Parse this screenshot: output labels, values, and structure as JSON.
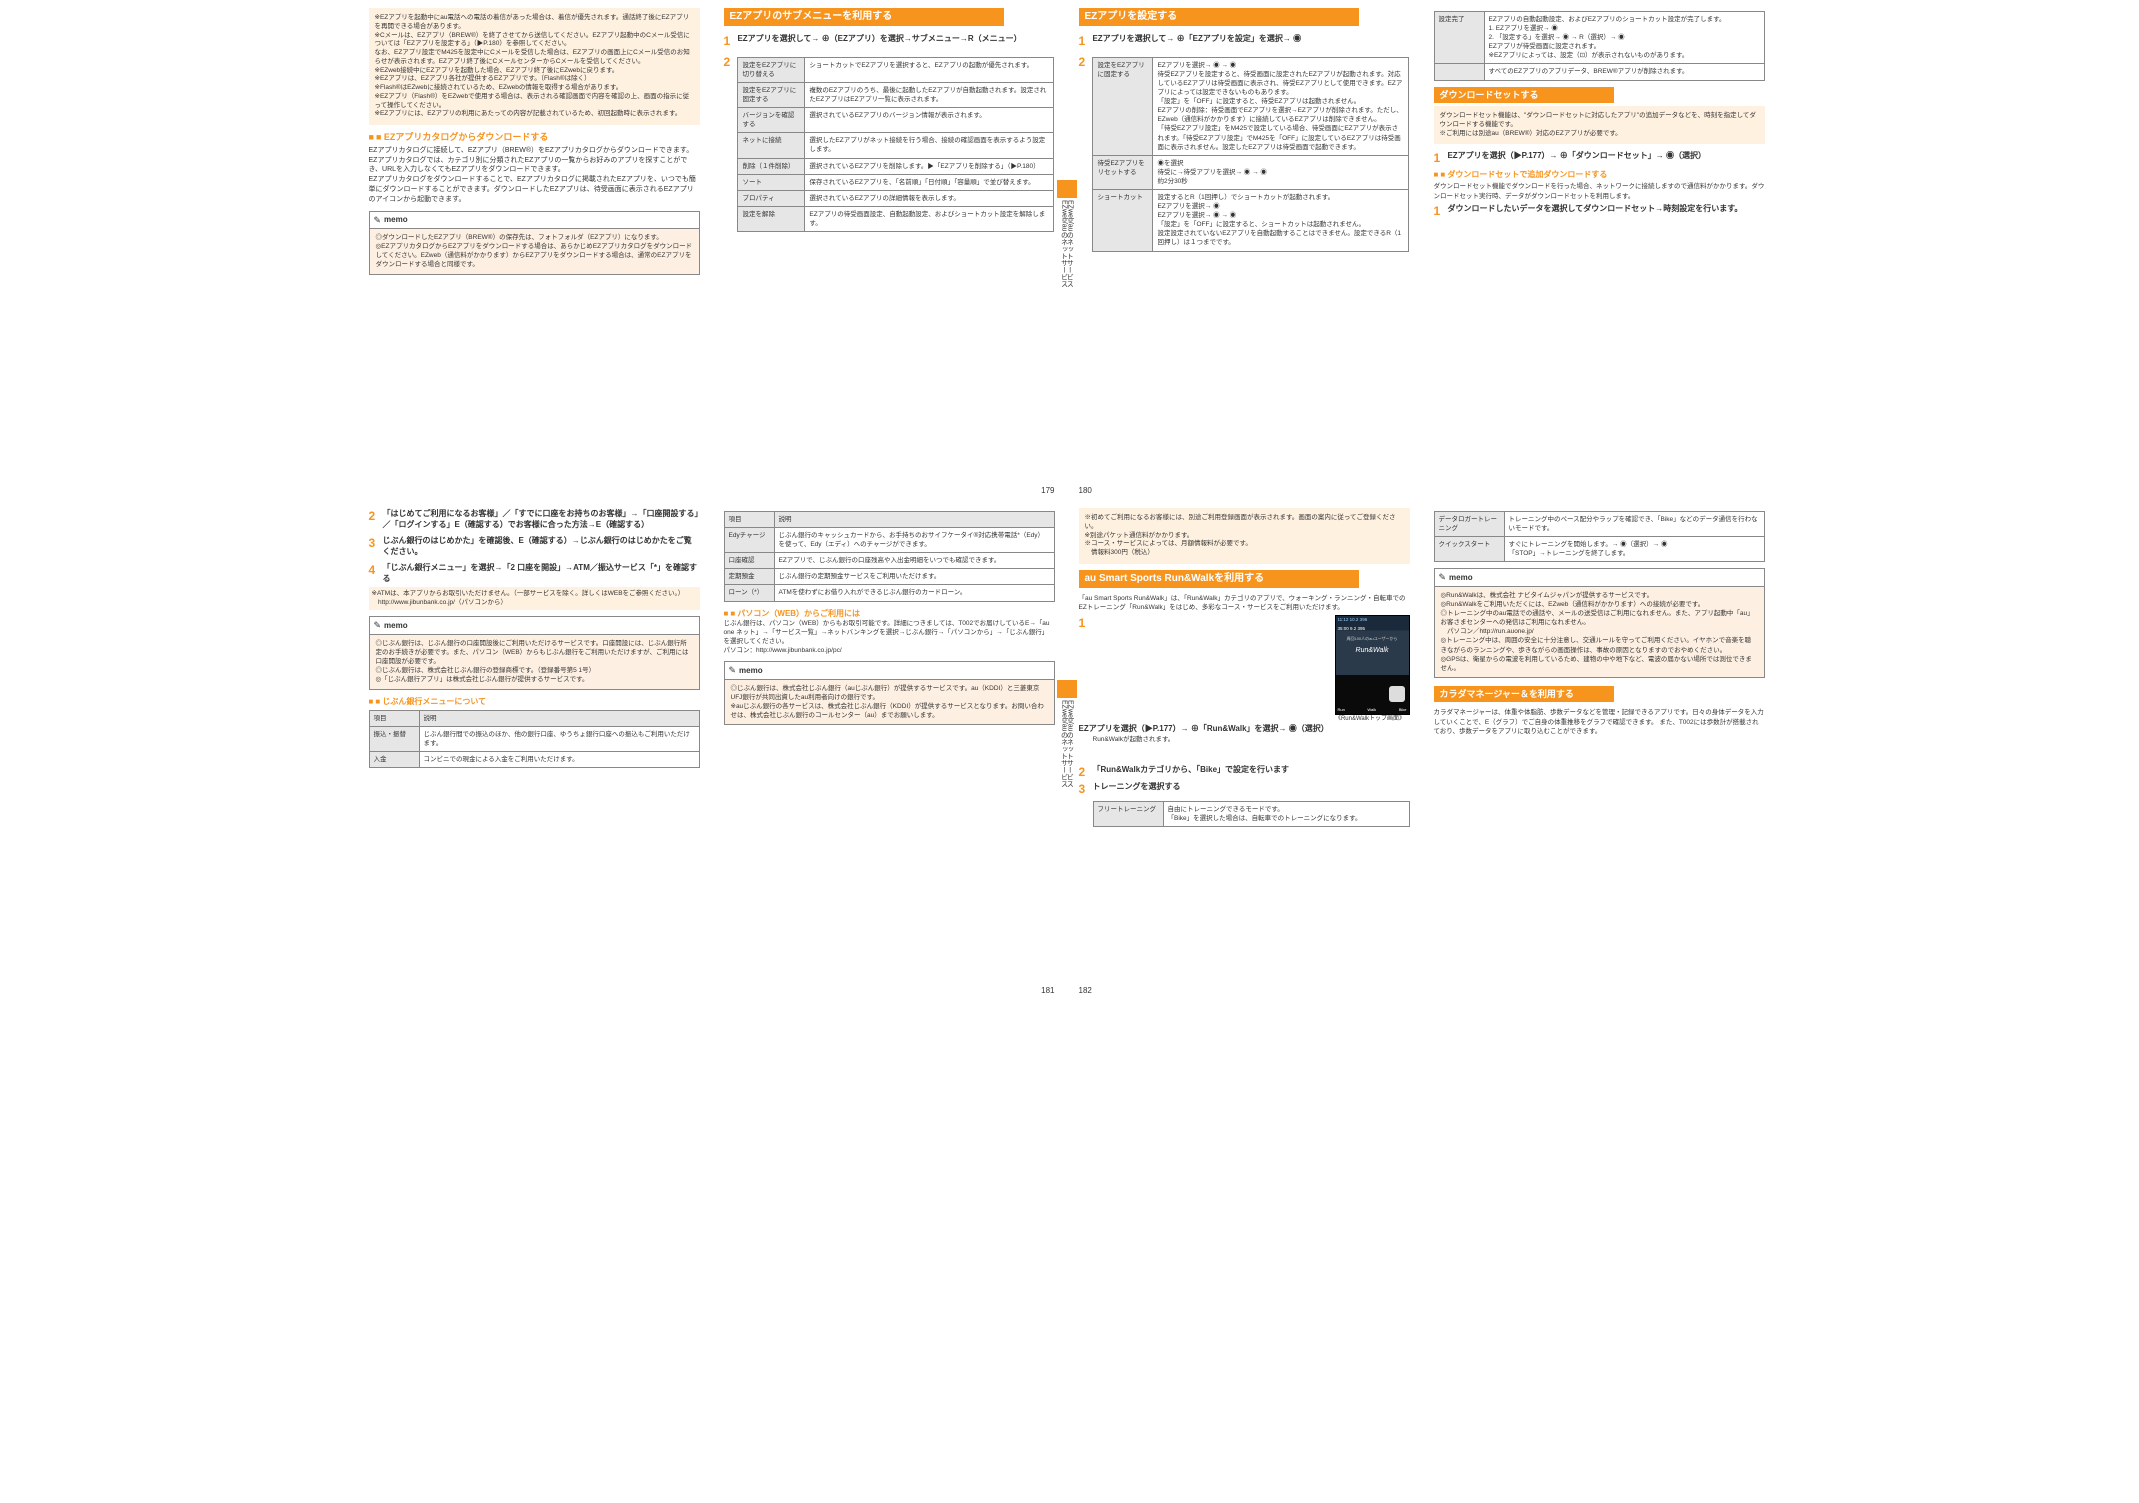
{
  "sidetab_label": "EZweb/auのネットサービス",
  "p179": {
    "note_text": "※EZアプリを起動中にau電話への電話の着信があった場合は、着信が優先されます。通話終了後にEZアプリを再開できる場合があります。\n※Cメールは、EZアプリ（BREW®）を終了させてから送信してください。EZアプリ起動中のCメール受信については「EZアプリを設定する」（▶P.180）を参照してください。\nなお、EZアプリ設定でM425を設定中にCメールを受信した場合は、EZアプリの画面上にCメール受信のお知らせが表示されます。EZアプリ終了後にCメールセンターからCメールを受信してください。\n※EZweb接続中にEZアプリを起動した場合、EZアプリ終了後にEZwebに戻ります。\n※EZアプリは、EZアプリ各社が提供するEZアプリです。（Flash®は除く）\n※Flash®はEZwebに接続されているため、EZwebの情報を取得する場合があります。\n※EZアプリ（Flash®）をEZwebで使用する場合は、表示される確認画面で内容を確認の上、画面の指示に従って操作してください。\n※EZアプリには、EZアプリの利用にあたっての内容が記載されているため、初回起動時に表示されます。",
    "heading1": "■ EZアプリカタログからダウンロードする",
    "body1": "EZアプリカタログに接続して、EZアプリ（BREW®）をEZアプリカタログからダウンロードできます。EZアプリカタログでは、カテゴリ別に分類されたEZアプリの一覧からお好みのアプリを探すことができ、URLを入力しなくてもEZアプリをダウンロードできます。\nEZアプリカタログをダウンロードすることで、EZアプリカタログに掲載されたEZアプリを、いつでも簡単にダウンロードすることができます。ダウンロードしたEZアプリは、待受画面に表示されるEZアプリのアイコンから起動できます。",
    "memo_label": "memo",
    "memo_body": "◎ダウンロードしたEZアプリ（BREW®）の保存先は、フォトフォルダ（EZアプリ）になります。\n◎EZアプリカタログからEZアプリをダウンロードする場合は、あらかじめEZアプリカタログをダウンロードしてください。EZweb（通信料がかかります）からEZアプリをダウンロードする場合は、通常のEZアプリをダウンロードする場合と同様です。",
    "sec_title": "EZアプリのサブメニューを利用する",
    "step1_label": "1",
    "step1_text": "EZアプリを選択して→ ⊕（EZアプリ）を選択→サブメニュー→R（メニュー）",
    "step2_label": "2",
    "table": [
      [
        "設定をEZアプリに切り替える",
        "ショートカットでEZアプリを選択すると、EZアプリの起動が優先されます。"
      ],
      [
        "設定をEZアプリに固定する",
        "複数のEZアプリのうち、最後に起動したEZアプリが自動起動されます。設定されたEZアプリはEZアプリ一覧に表示されます。"
      ],
      [
        "バージョンを確認する",
        "選択されているEZアプリのバージョン情報が表示されます。"
      ],
      [
        "ネットに接続",
        "選択したEZアプリがネット接続を行う場合、接続の確認画面を表示するよう設定します。"
      ],
      [
        "削除（１件削除）",
        "選択されているEZアプリを削除します。▶「EZアプリを削除する」（▶P.180）"
      ],
      [
        "ソート",
        "保存されているEZアプリを、「名前順」「日付順」「容量順」で並び替えます。"
      ],
      [
        "プロパティ",
        "選択されているEZアプリの詳細情報を表示します。"
      ],
      [
        "設定を解除",
        "EZアプリの待受画面設定、自動起動設定、およびショートカット設定を解除します。"
      ]
    ],
    "pagenum": "179"
  },
  "p180": {
    "sec_title": "EZアプリを設定する",
    "step1_label": "1",
    "step1_text": "EZアプリを選択して→ ⊕「EZアプリを設定」を選択→ ◉",
    "step2_label": "2",
    "table": [
      {
        "h": "設定をEZアプリに固定する",
        "rows": [
          "EZアプリを選択→ ◉ → ◉\n待受EZアプリを設定すると、待受画面に設定されたEZアプリが起動されます。対応しているEZアプリは待受画面に表示され、待受EZアプリとして使用できます。EZアプリによっては設定できないものもあります。\n「設定」を「OFF」に設定すると、待受EZアプリは起動されません。\nEZアプリの削除：待受画面でEZアプリを選択→EZアプリが削除されます。ただし、EZweb（通信料がかかります）に接続しているEZアプリは削除できません。\n「待受EZアプリ設定」をM425で設定している場合、待受画面にEZアプリが表示されます。「待受EZアプリ設定」でM425を「OFF」に設定しているEZアプリは待受画面に表示されません。設定したEZアプリは待受画面で起動できます。"
        ]
      },
      {
        "h": "待受EZアプリをリセットする",
        "rows": [
          "◉を選択\n待受に→待受アプリを選択→ ◉ → ◉\n約2分30秒"
        ]
      },
      {
        "h": "ショートカット",
        "rows": [
          "設定するとR（1回押し）でショートカットが起動されます。\nEZアプリを選択→ ◉\nEZアプリを選択→ ◉ → ◉\n「設定」を「OFF」に設定すると、ショートカットは起動されません。\n設定設定されていないEZアプリを自動起動することはできません。設定できるR（1回押し）は１つまでです。"
        ]
      }
    ],
    "side_table": [
      [
        "設定完了",
        "EZアプリの自動起動設定、およびEZアプリのショートカット設定が完了します。\n1. EZアプリを選択→ ◉\n2. 「設定する」を選択→ ◉ → R（選択）→ ◉\nEZアプリが待受画面に設定されます。\n※EZアプリによっては、設定（⊡）が表示されないものがあります。"
      ],
      [
        "",
        "すべてのEZアプリのアプリデータ、BREW®アプリが削除されます。"
      ]
    ],
    "pagenum": "180"
  },
  "p180r": {
    "sec_title": "ダウンロードセットする",
    "note": "ダウンロードセット機能は、\"ダウンロードセットに対応したアプリ\"の追加データなどを、時刻を指定してダウンロードする機能です。\n※ご利用には別途au（BREW®）対応のEZアプリが必要です。",
    "step1_label": "1",
    "step1_text": "EZアプリを選択（▶P.177）→ ⊕「ダウンロードセット」→ ◉（選択）",
    "sub_heading": "■ ダウンロードセットで追加ダウンロードする",
    "body": "ダウンロードセット機能でダウンロードを行った場合、ネットワークに接続しますので通信料がかかります。ダウンロードセット実行時、データがダウンロードセットを利用します。",
    "step1b_label": "1",
    "step1b_text": "ダウンロードしたいデータを選択してダウンロードセット→時刻設定を行います。"
  },
  "p181": {
    "step2_label": "2",
    "step2_text": "「はじめてご利用になるお客様」／「すでに口座をお持ちのお客様」→「口座開設する」／「ログインする」E（確認する）でお客様に合った方法→E（確認する）",
    "step3_label": "3",
    "step3_text": "じぶん銀行のはじめかた」を確認後、E（確認する）→じぶん銀行のはじめかたをご覧ください。",
    "step4_label": "4",
    "step4_text": "「じぶん銀行メニュー」を選択→「2 口座を開設」→ATM／振込サービス「*」を確認する",
    "footnote4": "※ATMは、本アプリからお取引いただけません。（一部サービスを除く。詳しくはWEBをご参照ください。）\n　http://www.jibunbank.co.jp/（パソコンから）",
    "memo_label": "memo",
    "memo_body": "◎じぶん銀行は、じぶん銀行の口座開設後にご利用いただけるサービスです。口座開設には、じぶん銀行所定のお手続きが必要です。また、パソコン（WEB）からもじぶん銀行をご利用いただけますが、ご利用には口座開設が必要です。\n◎じぶん銀行は、株式会社じぶん銀行の登録商標です。（登録番号第5 1号）\n◎「じぶん銀行アプリ」は株式会社じぶん銀行が提供するサービスです。",
    "sub_heading": "■ じぶん銀行メニューについて",
    "table1": [
      [
        "項目",
        "説明"
      ],
      [
        "振込・振替",
        "じぶん銀行間での振込のほか、他の銀行口座、ゆうちょ銀行口座への振込もご利用いただけます。"
      ],
      [
        "入金",
        "コンビニでの現金による入金をご利用いただけます。"
      ]
    ],
    "table2": [
      [
        "項目",
        "説明"
      ],
      [
        "Edyチャージ",
        "じぶん銀行のキャッシュカードから、お手持ちのおサイフケータイ®対応携帯電話*（Edy）を使って、Edy（エディ）へのチャージができます。"
      ],
      [
        "口座確認",
        "EZアプリで、じぶん銀行の口座残高や入出金明細をいつでも確認できます。"
      ],
      [
        "定期預金",
        "じぶん銀行の定期預金サービスをご利用いただけます。"
      ],
      [
        "ローン（*）",
        "ATMを使わずにお借り入れができるじぶん銀行のカードローン。"
      ]
    ],
    "sec_web": "■ パソコン（WEB）からご利用には",
    "web_body": "じぶん銀行は、パソコン（WEB）からもお取引可能です。詳細につきましては、T002でお届けしているE→「au one ネット」→「サービス一覧」→ネットバンキングを選択→じぶん銀行→「パソコンから」→「じぶん銀行」を選択してください。\nパソコン：http://www.jibunbank.co.jp/pc/",
    "memo2_body": "◎じぶん銀行は、株式会社じぶん銀行（auじぶん銀行）が提供するサービスです。au（KDDI）と三菱東京UFJ銀行が共同出資したau利用者向けの銀行です。\n※auじぶん銀行の各サービスは、株式会社じぶん銀行（KDDI）が提供するサービスとなります。お問い合わせは、株式会社じぶん銀行のコールセンター（au）までお願いします。",
    "pagenum": "181"
  },
  "p182": {
    "top_note": "※初めてご利用になるお客様には、別途ご利用登録画面が表示されます。画面の案内に従ってご登録ください。\n※別途パケット通信料がかかります。\n※コース・サービスによっては、月額情報料が必要です。\n　情報料300円（税込）",
    "sec_title": "au Smart Sports Run&Walkを利用する",
    "intro": "「au Smart Sports Run&Walk」は、「Run&Walk」カテゴリのアプリで、ウォーキング・ランニング・自転車でのEZトレーニング「Run&Walk」をはじめ、多彩なコース・サービスをご利用いただけます。",
    "step1_label": "1",
    "step1_text": "EZアプリを選択（▶P.177）→ ⊕「Run&Walk」を選択→ ◉（選択）",
    "step1_sub": "Run&Walkが起動されます。",
    "step2_label": "2",
    "step2_text": "「Run&Walkカテゴリから、「Bike」で設定を行います",
    "step3_label": "3",
    "step3_text": "トレーニングを選択する",
    "table": [
      [
        "フリートレーニング",
        "自由にトレーニングできるモードです。\n「Bike」を選択した場合は、自転車でのトレーニングになります。"
      ]
    ],
    "screenshot_caption": "《Run&Walkトップ画面》",
    "scr": {
      "top": "11:12  10.2  396",
      "mid": "35:00  9.2  395",
      "blurb": "周回100人のauユーザーから",
      "title": "Run&Walk",
      "menu1": "Run",
      "menu2": "Walk",
      "menu3": "Bike"
    },
    "right_table": [
      [
        "データロガートレーニング",
        "トレーニング中のペース配分やラップを確認でき、「Bike」などのデータ通信を行わないモードです。"
      ],
      [
        "クイックスタート",
        "すぐにトレーニングを開始します。→ ◉（選択）→ ◉\n「STOP」→トレーニングを終了します。"
      ]
    ],
    "memo_label": "memo",
    "memo_body": "◎Run&Walkは、株式会社 ナビタイムジャパンが提供するサービスです。\n◎Run&Walkをご利用いただくには、EZweb（通信料がかかります）への接続が必要です。\n◎トレーニング中のau電話での通話や、メールの送受信はご利用になれません。また、アプリ起動中「au」お客さまセンターへの発信はご利用になれません。\n　パソコン／http://run.auone.jp/\n◎トレーニング中は、周囲の安全に十分注意し、交通ルールを守ってご利用ください。イヤホンで音楽を聴きながらのランニングや、歩きながらの画面操作は、事故の原因となりますのでおやめください。\n◎GPSは、衛星からの電波を利用しているため、建物の中や地下など、電波の届かない場所では測位できません。",
    "sec2_title": "カラダマネージャー＆を利用する",
    "sec2_body": "カラダマネージャーは、体重や体脂肪、歩数データなどを管理・記録できるアプリです。日々の身体データを入力していくことで、E（グラフ）でご自身の体重推移をグラフで確認できます。\nまた、T002には歩数計が搭載されており、歩数データをアプリに取り込むことができます。",
    "pagenum": "182"
  }
}
